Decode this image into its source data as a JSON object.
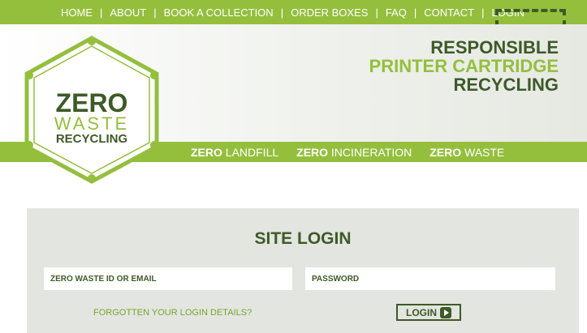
{
  "nav": {
    "items": [
      "HOME",
      "ABOUT",
      "BOOK A COLLECTION",
      "ORDER BOXES",
      "FAQ",
      "CONTACT",
      "LOGIN"
    ],
    "separator": "|"
  },
  "tagline": {
    "line1": "RESPONSIBLE",
    "line2": "PRINTER CARTRIDGE",
    "line3": "RECYCLING"
  },
  "logo": {
    "line1": "ZERO",
    "line2": "WASTE",
    "line3": "RECYCLING"
  },
  "slogans": [
    {
      "bold": "ZERO",
      "rest": " LANDFILL"
    },
    {
      "bold": "ZERO",
      "rest": " INCINERATION"
    },
    {
      "bold": "ZERO",
      "rest": " WASTE"
    }
  ],
  "login": {
    "title": "SITE LOGIN",
    "id_placeholder": "ZERO WASTE ID OR EMAIL",
    "password_placeholder": "PASSWORD",
    "forgot_text": "FORGOTTEN YOUR LOGIN DETAILS?",
    "button_label": "LOGIN"
  },
  "colors": {
    "brand_green": "#94bf3d",
    "dark_green": "#3e5a27",
    "panel_bg": "#e3e5e0"
  }
}
